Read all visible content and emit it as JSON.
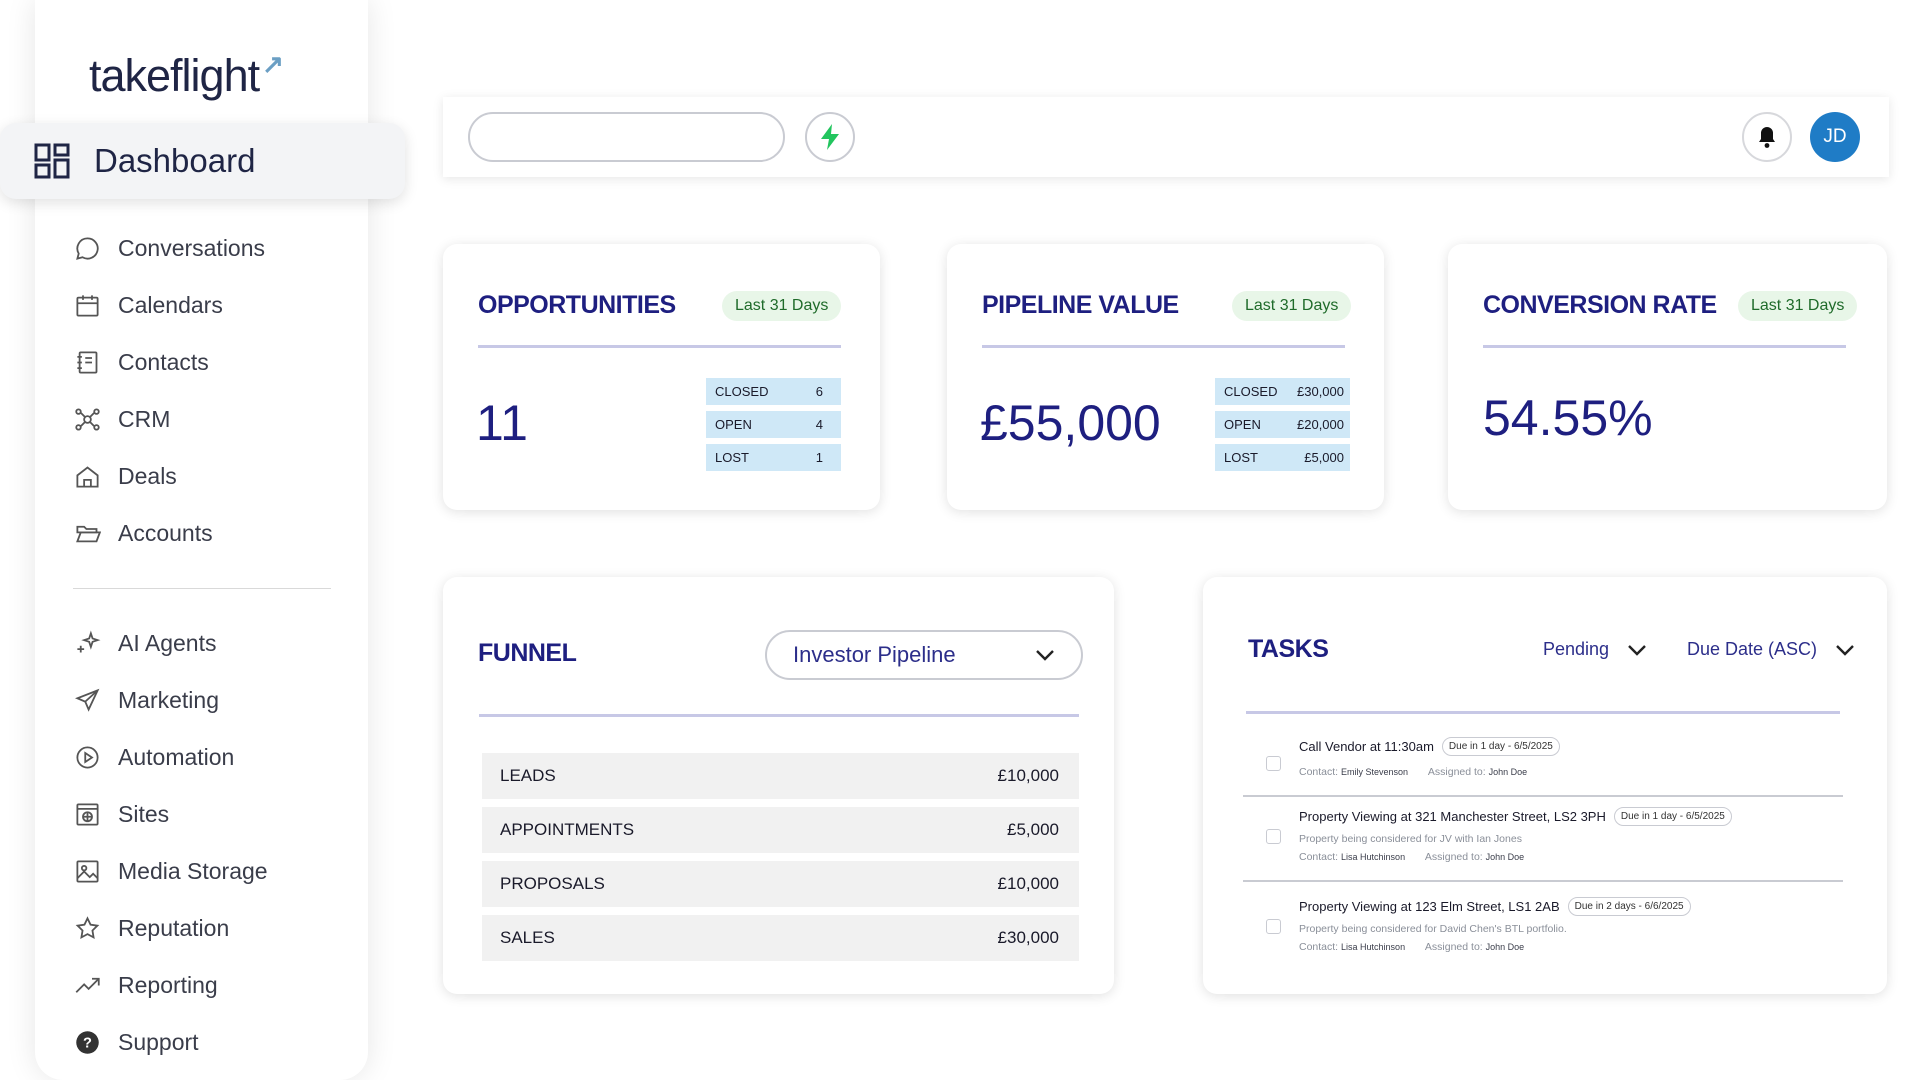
{
  "brand": {
    "name": "takeflight",
    "mark": "↗"
  },
  "sidebar": {
    "active": "Dashboard",
    "items": [
      {
        "label": "Conversations",
        "icon": "chat-bubble-icon"
      },
      {
        "label": "Calendars",
        "icon": "calendar-icon"
      },
      {
        "label": "Contacts",
        "icon": "contacts-book-icon"
      },
      {
        "label": "CRM",
        "icon": "crm-network-icon"
      },
      {
        "label": "Deals",
        "icon": "home-icon"
      },
      {
        "label": "Accounts",
        "icon": "folder-open-icon"
      }
    ],
    "items2": [
      {
        "label": "AI Agents",
        "icon": "sparkles-icon"
      },
      {
        "label": "Marketing",
        "icon": "paper-plane-icon"
      },
      {
        "label": "Automation",
        "icon": "play-circle-icon"
      },
      {
        "label": "Sites",
        "icon": "globe-window-icon"
      },
      {
        "label": "Media Storage",
        "icon": "image-icon"
      },
      {
        "label": "Reputation",
        "icon": "star-icon"
      },
      {
        "label": "Reporting",
        "icon": "trend-up-icon"
      },
      {
        "label": "Support",
        "icon": "help-circle-icon"
      }
    ]
  },
  "header": {
    "search_placeholder": "",
    "avatar_initials": "JD"
  },
  "opportunities": {
    "title": "OPPORTUNITIES",
    "badge": "Last 31 Days",
    "value": "11",
    "rows": [
      {
        "label": "CLOSED",
        "value": "6"
      },
      {
        "label": "OPEN",
        "value": "4"
      },
      {
        "label": "LOST",
        "value": "1"
      }
    ]
  },
  "pipeline": {
    "title": "PIPELINE VALUE",
    "badge": "Last 31 Days",
    "value": "£55,000",
    "rows": [
      {
        "label": "CLOSED",
        "value": "£30,000"
      },
      {
        "label": "OPEN",
        "value": "£20,000"
      },
      {
        "label": "LOST",
        "value": "£5,000"
      }
    ]
  },
  "conversion": {
    "title": "CONVERSION RATE",
    "badge": "Last 31 Days",
    "value": "54.55%"
  },
  "funnel": {
    "title": "FUNNEL",
    "selected": "Investor Pipeline",
    "rows": [
      {
        "label": "LEADS",
        "value": "£10,000"
      },
      {
        "label": "APPOINTMENTS",
        "value": "£5,000"
      },
      {
        "label": "PROPOSALS",
        "value": "£10,000"
      },
      {
        "label": "SALES",
        "value": "£30,000"
      }
    ]
  },
  "tasks": {
    "title": "TASKS",
    "status_filter": "Pending",
    "sort_filter": "Due Date (ASC)",
    "items": [
      {
        "title": "Call Vendor at 11:30am",
        "due": "Due in 1 day - 6/5/2025",
        "desc": "",
        "contact_label": "Contact:",
        "contact": "Emily Stevenson",
        "assigned_label": "Assigned to:",
        "assigned": "John Doe"
      },
      {
        "title": "Property Viewing at 321 Manchester Street, LS2 3PH",
        "due": "Due in 1 day - 6/5/2025",
        "desc": "Property being considered for JV with Ian Jones",
        "contact_label": "Contact:",
        "contact": "Lisa Hutchinson",
        "assigned_label": "Assigned to:",
        "assigned": "John Doe"
      },
      {
        "title": "Property Viewing at 123 Elm Street, LS1 2AB",
        "due": "Due in 2 days - 6/6/2025",
        "desc": "Property being considered for David Chen's BTL portfolio.",
        "contact_label": "Contact:",
        "contact": "Lisa Hutchinson",
        "assigned_label": "Assigned to:",
        "assigned": "John Doe"
      }
    ]
  },
  "colors": {
    "accent": "#1e1f80",
    "badge_bg": "#e8f6e8",
    "mini_row": "#cfe8f7",
    "avatar": "#1f7cc6",
    "bolt": "#22c55e"
  }
}
